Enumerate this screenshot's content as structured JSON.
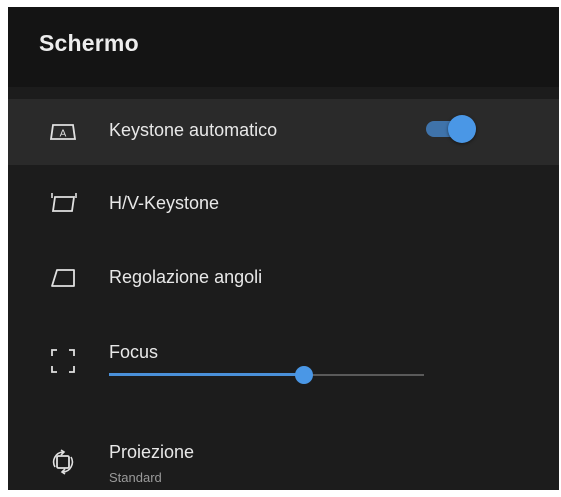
{
  "header": {
    "title": "Schermo"
  },
  "menu": {
    "auto_keystone": {
      "label": "Keystone automatico",
      "icon": "keystone-auto-icon",
      "toggle_on": true
    },
    "hv_keystone": {
      "label": "H/V-Keystone",
      "icon": "keystone-hv-icon"
    },
    "corner_adjust": {
      "label": "Regolazione angoli",
      "icon": "corner-adjust-icon"
    },
    "focus": {
      "label": "Focus",
      "icon": "focus-icon",
      "value_fraction": 0.62
    },
    "projection": {
      "label": "Proiezione",
      "value": "Standard",
      "icon": "rotate-screen-icon"
    }
  },
  "colors": {
    "accent": "#4a97e6",
    "background": "#1c1c1c",
    "header_background": "#141414",
    "highlight_row": "#2a2a2a"
  }
}
